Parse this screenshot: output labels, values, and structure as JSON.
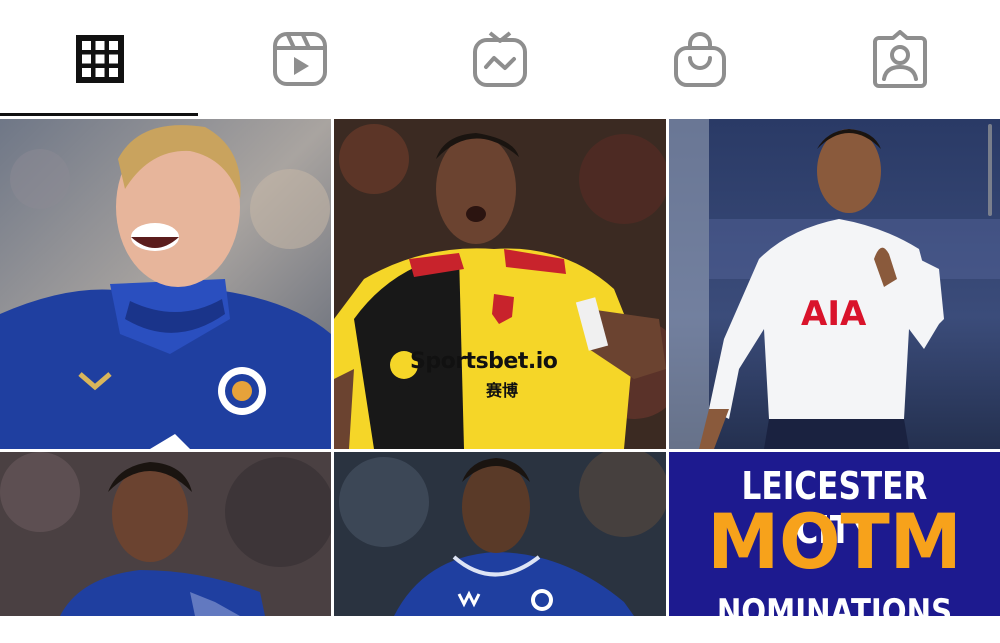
{
  "tabs": [
    {
      "name": "posts-grid",
      "icon": "grid-icon",
      "active": true
    },
    {
      "name": "reels",
      "icon": "reels-icon",
      "active": false
    },
    {
      "name": "igtv",
      "icon": "igtv-icon",
      "active": false
    },
    {
      "name": "shop",
      "icon": "shop-bag-icon",
      "active": false
    },
    {
      "name": "tagged",
      "icon": "tagged-user-icon",
      "active": false
    }
  ],
  "posts": [
    {
      "subject": "player-blue-kit-shouting",
      "badge": "LEICESTER CITY FOOTBALL CLUB"
    },
    {
      "subject": "player-yellow-black-kit",
      "sponsor_text": "Sportsbet.io",
      "sponsor_sub": "赛博"
    },
    {
      "subject": "player-white-kit",
      "sponsor_text": "AIA"
    },
    {
      "subject": "player-blue-kit-young"
    },
    {
      "subject": "player-blue-kit-adidas"
    },
    {
      "headline_1": "LEICESTER CITY",
      "headline_2": "MOTM",
      "headline_3": "NOMINATIONS"
    }
  ],
  "colors": {
    "accent": "#111111",
    "icon_inactive": "#8e8e8e",
    "leicester_blue": "#1f3fa0",
    "watford_yellow": "#f5d628",
    "spurs_white": "#f4f5f7",
    "motm_bg": "#1d1a8f",
    "motm_orange": "#f7a21b"
  }
}
